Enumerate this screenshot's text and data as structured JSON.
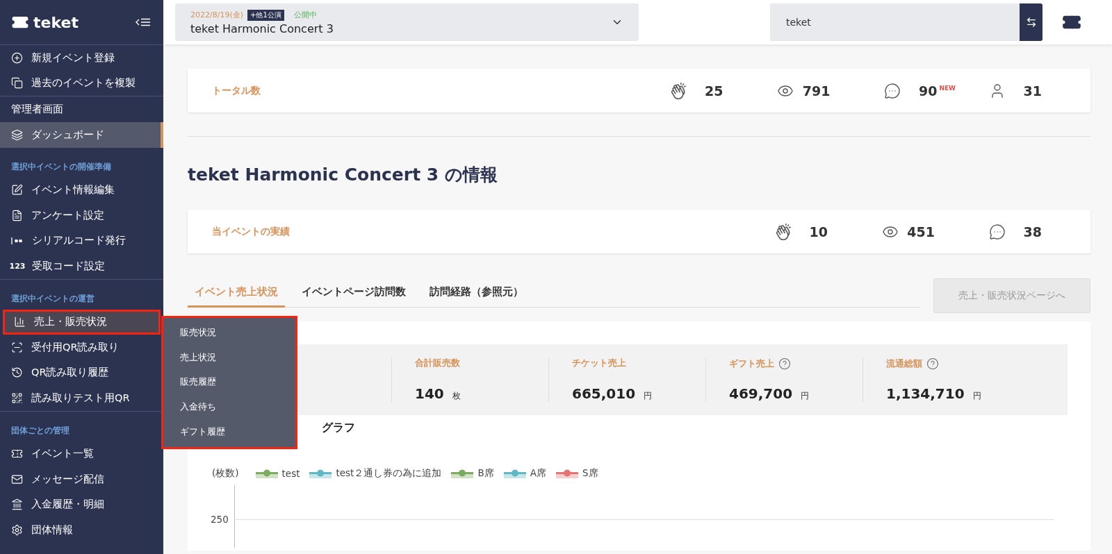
{
  "sidebar": {
    "logo": "teket",
    "groups": [
      {
        "rule_above": true,
        "items": [
          {
            "label": "新規イベント登録",
            "selected": false,
            "expanded": false
          },
          {
            "label": "過去のイベントを複製",
            "selected": false,
            "expanded": false
          }
        ]
      },
      {
        "rule_above": true,
        "heading": "管理者画面",
        "items": [
          {
            "label": "ダッシュボード",
            "selected": true,
            "expanded": false
          }
        ]
      },
      {
        "rule_above": false,
        "title": "選択中イベントの開催準備",
        "items": [
          {
            "label": "イベント情報編集",
            "selected": false,
            "expanded": false
          },
          {
            "label": "アンケート設定",
            "selected": false,
            "expanded": false
          },
          {
            "label": "シリアルコード発行",
            "selected": false,
            "expanded": false
          },
          {
            "label": "受取コード設定",
            "icon_text": "123",
            "selected": false,
            "expanded": false
          }
        ]
      },
      {
        "rule_above": true,
        "title": "選択中イベントの運営",
        "items": [
          {
            "label": "売上・販売状況",
            "selected": false,
            "expanded": true,
            "submenu": [
              "販売状況",
              "売上状況",
              "販売履歴",
              "入金待ち",
              "ギフト履歴"
            ]
          },
          {
            "label": "受付用QR読み取り",
            "selected": false,
            "expanded": false
          },
          {
            "label": "QR読み取り履歴",
            "selected": false,
            "expanded": false
          },
          {
            "label": "読み取りテスト用QR",
            "selected": false,
            "expanded": false
          }
        ]
      },
      {
        "rule_above": true,
        "title": "団体ごとの管理",
        "items": [
          {
            "label": "イベント一覧",
            "selected": false,
            "expanded": false
          },
          {
            "label": "メッセージ配信",
            "selected": false,
            "expanded": false
          },
          {
            "label": "入金履歴・明細",
            "selected": false,
            "expanded": false
          },
          {
            "label": "団体情報",
            "selected": false,
            "expanded": false
          }
        ]
      }
    ]
  },
  "topbar": {
    "event": {
      "date": "2022/8/19(金)",
      "badge": "+他1公演",
      "status": "公開中",
      "title": "teket Harmonic Concert 3"
    },
    "search": {
      "value": "teket"
    }
  },
  "total_card": {
    "label": "トータル数",
    "stats": [
      {
        "value": "25"
      },
      {
        "value": "791"
      },
      {
        "value": "90",
        "badge": "NEW"
      },
      {
        "value": "31"
      }
    ]
  },
  "heading": "teket Harmonic Concert 3 の情報",
  "event_card": {
    "label": "当イベントの実績",
    "stats": [
      {
        "value": "10"
      },
      {
        "value": "451"
      },
      {
        "value": "38"
      }
    ]
  },
  "tabs": [
    {
      "label": "イベント売上状況",
      "selected": true
    },
    {
      "label": "イベントページ訪問数",
      "selected": false
    },
    {
      "label": "訪問経路（参照元）",
      "selected": false
    }
  ],
  "page_button": {
    "label": "売上・販売状況ページへ",
    "disabled": true
  },
  "summary": [
    {
      "label": "合計販売数",
      "value": "140",
      "unit": "枚",
      "help": false
    },
    {
      "label": "チケット売上",
      "value": "665,010",
      "unit": "円",
      "help": false
    },
    {
      "label": "ギフト売上",
      "value": "469,700",
      "unit": "円",
      "help": true
    },
    {
      "label": "流通総額",
      "value": "1,134,710",
      "unit": "円",
      "help": true
    }
  ],
  "chart": {
    "title": "グラフ",
    "unit": "(枚数)",
    "tick": "250",
    "legend": [
      {
        "name": "test",
        "color": "#7aab5e"
      },
      {
        "name": "test２通し券の為に追加",
        "color": "#5fb8c4"
      },
      {
        "name": "B席",
        "color": "#7aab5e"
      },
      {
        "name": "A席",
        "color": "#5fb8c4"
      },
      {
        "name": "S席",
        "color": "#e57373"
      }
    ]
  }
}
